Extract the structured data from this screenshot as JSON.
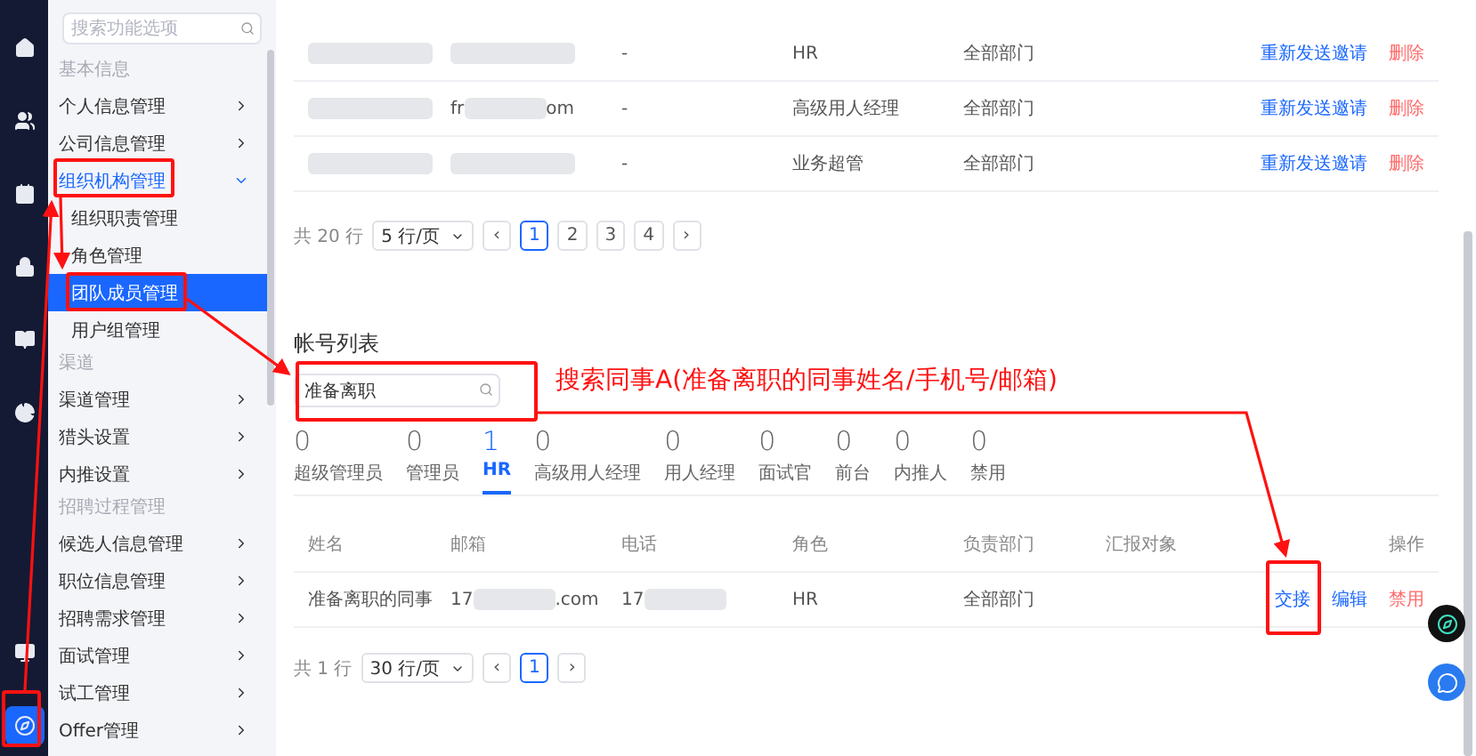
{
  "rail": {
    "items": [
      {
        "selected": false
      },
      {
        "selected": false
      },
      {
        "selected": false
      },
      {
        "selected": false
      },
      {
        "selected": false
      },
      {
        "selected": false
      },
      {
        "selected": false
      },
      {
        "selected": true
      }
    ]
  },
  "sidebar": {
    "search": {
      "placeholder": "搜索功能选项"
    },
    "groups": [
      {
        "label": "基本信息",
        "items": [
          {
            "label": "个人信息管理",
            "expanded": false,
            "selected": false
          },
          {
            "label": "公司信息管理",
            "expanded": false,
            "selected": false
          },
          {
            "label": "组织机构管理",
            "expanded": true,
            "selected": true,
            "children": [
              {
                "label": "组织职责管理",
                "selected": false
              },
              {
                "label": "角色管理",
                "selected": false
              },
              {
                "label": "团队成员管理",
                "selected": true
              },
              {
                "label": "用户组管理",
                "selected": false
              }
            ]
          }
        ]
      },
      {
        "label": "渠道",
        "items": [
          {
            "label": "渠道管理",
            "expanded": false,
            "selected": false
          },
          {
            "label": "猎头设置",
            "expanded": false,
            "selected": false
          },
          {
            "label": "内推设置",
            "expanded": false,
            "selected": false
          }
        ]
      },
      {
        "label": "招聘过程管理",
        "items": [
          {
            "label": "候选人信息管理",
            "expanded": false,
            "selected": false
          },
          {
            "label": "职位信息管理",
            "expanded": false,
            "selected": false
          },
          {
            "label": "招聘需求管理",
            "expanded": false,
            "selected": false
          },
          {
            "label": "面试管理",
            "expanded": false,
            "selected": false
          },
          {
            "label": "试工管理",
            "expanded": false,
            "selected": false
          },
          {
            "label": "Offer管理",
            "expanded": false,
            "selected": false
          }
        ]
      }
    ]
  },
  "invites": {
    "rows": [
      {
        "name": {
          "kind": "redacted"
        },
        "email": {
          "kind": "redacted"
        },
        "phone": "-",
        "role": "HR",
        "dept": "全部部门",
        "actions": [
          "重新发送邀请",
          "删除"
        ]
      },
      {
        "name": {
          "kind": "redacted"
        },
        "email": {
          "kind": "redacted",
          "prefix": "fr",
          "suffix": "om"
        },
        "phone": "-",
        "role": "高级用人经理",
        "dept": "全部部门",
        "actions": [
          "重新发送邀请",
          "删除"
        ]
      },
      {
        "name": {
          "kind": "redacted"
        },
        "email": {
          "kind": "redacted"
        },
        "phone": "-",
        "role": "业务超管",
        "dept": "全部部门",
        "actions": [
          "重新发送邀请",
          "删除"
        ]
      }
    ],
    "pagination": {
      "total": "共 20 行",
      "page_size": "5 行/页",
      "prev": "‹",
      "next": "›",
      "pages": [
        {
          "label": "1",
          "selected": true
        },
        {
          "label": "2",
          "selected": false
        },
        {
          "label": "3",
          "selected": false
        },
        {
          "label": "4",
          "selected": false
        }
      ]
    }
  },
  "accounts": {
    "title": "帐号列表",
    "search": {
      "value": "准备离职"
    },
    "tabs": [
      {
        "count": "0",
        "label": "超级管理员",
        "selected": false
      },
      {
        "count": "0",
        "label": "管理员",
        "selected": false
      },
      {
        "count": "1",
        "label": "HR",
        "selected": true
      },
      {
        "count": "0",
        "label": "高级用人经理",
        "selected": false
      },
      {
        "count": "0",
        "label": "用人经理",
        "selected": false
      },
      {
        "count": "0",
        "label": "面试官",
        "selected": false
      },
      {
        "count": "0",
        "label": "前台",
        "selected": false
      },
      {
        "count": "0",
        "label": "内推人",
        "selected": false
      },
      {
        "count": "0",
        "label": "禁用",
        "selected": false
      }
    ],
    "columns": [
      "姓名",
      "邮箱",
      "电话",
      "角色",
      "负责部门",
      "汇报对象",
      "操作"
    ],
    "rows": [
      {
        "name": "准备离职的同事",
        "email": {
          "kind": "redacted",
          "prefix": "17",
          "suffix": ".com"
        },
        "phone": {
          "kind": "redacted",
          "prefix": "17"
        },
        "role": "HR",
        "dept": "全部部门",
        "actions": [
          "交接",
          "编辑",
          "禁用"
        ]
      }
    ],
    "pagination": {
      "total": "共 1 行",
      "page_size": "30 行/页",
      "prev": "‹",
      "next": "›",
      "pages": [
        {
          "label": "1",
          "selected": true
        }
      ]
    }
  },
  "annotation": {
    "text": "搜索同事A(准备离职的同事姓名/手机号/邮箱)"
  }
}
